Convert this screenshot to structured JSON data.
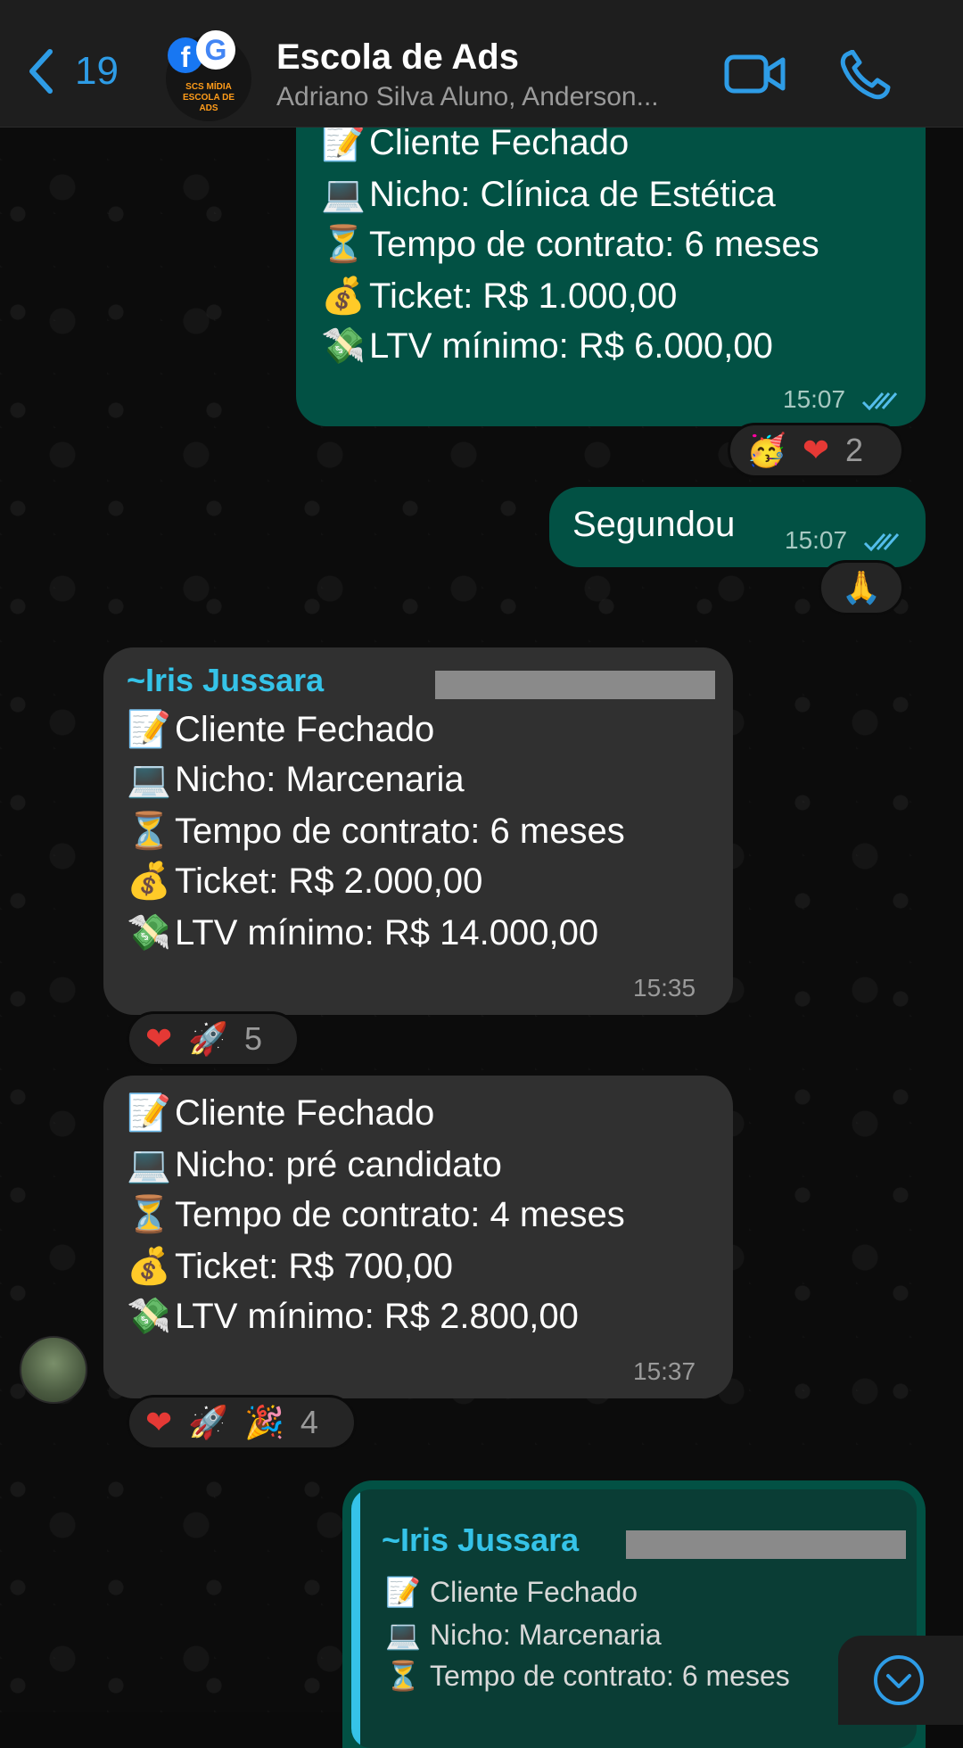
{
  "header": {
    "back_count": "19",
    "title": "Escola de Ads",
    "subtitle": "Adriano Silva Aluno, Anderson...",
    "avatar_text": "SCS MÍDIA ESCOLA DE ADS"
  },
  "messages": {
    "m1": {
      "lines": [
        {
          "emoji": "📝",
          "text": "Cliente Fechado"
        },
        {
          "emoji": "💻",
          "text": "Nicho: Clínica de Estética"
        },
        {
          "emoji": "⏳",
          "text": "Tempo de contrato: 6 meses"
        },
        {
          "emoji": "💰",
          "text": "Ticket: R$ 1.000,00"
        },
        {
          "emoji": "💸",
          "text": "LTV mínimo: R$ 6.000,00"
        }
      ],
      "time": "15:07",
      "reaction_count": "2"
    },
    "m2": {
      "text": "Segundou",
      "time": "15:07"
    },
    "m3": {
      "sender": "~Iris Jussara",
      "lines": [
        {
          "emoji": "📝",
          "text": "Cliente Fechado"
        },
        {
          "emoji": "💻",
          "text": "Nicho: Marcenaria"
        },
        {
          "emoji": "⏳",
          "text": "Tempo de contrato: 6 meses"
        },
        {
          "emoji": "💰",
          "text": "Ticket: R$ 2.000,00"
        },
        {
          "emoji": "💸",
          "text": "LTV mínimo: R$ 14.000,00"
        }
      ],
      "time": "15:35",
      "reaction_count": "5"
    },
    "m4": {
      "lines": [
        {
          "emoji": "📝",
          "text": "Cliente Fechado"
        },
        {
          "emoji": "💻",
          "text": "Nicho: pré candidato"
        },
        {
          "emoji": "⏳",
          "text": "Tempo de contrato: 4 meses"
        },
        {
          "emoji": "💰",
          "text": "Ticket: R$ 700,00"
        },
        {
          "emoji": "💸",
          "text": "LTV mínimo: R$ 2.800,00"
        }
      ],
      "time": "15:37",
      "reaction_count": "4"
    },
    "m5": {
      "quote_sender": "~Iris Jussara",
      "quote_lines": [
        {
          "emoji": "📝",
          "text": "Cliente Fechado"
        },
        {
          "emoji": "💻",
          "text": "Nicho: Marcenaria"
        },
        {
          "emoji": "⏳",
          "text": "Tempo de contrato: 6 meses"
        }
      ]
    }
  },
  "reactions": {
    "heart": "❤",
    "rocket": "🚀",
    "party": "🎉",
    "partying_face": "🥳",
    "pray": "🙏"
  },
  "colors": {
    "accent": "#2e9ce6",
    "outgoing_bubble": "#025144",
    "incoming_bubble": "#303030",
    "sender_name": "#35c3e8",
    "read_ticks": "#53bdeb"
  }
}
